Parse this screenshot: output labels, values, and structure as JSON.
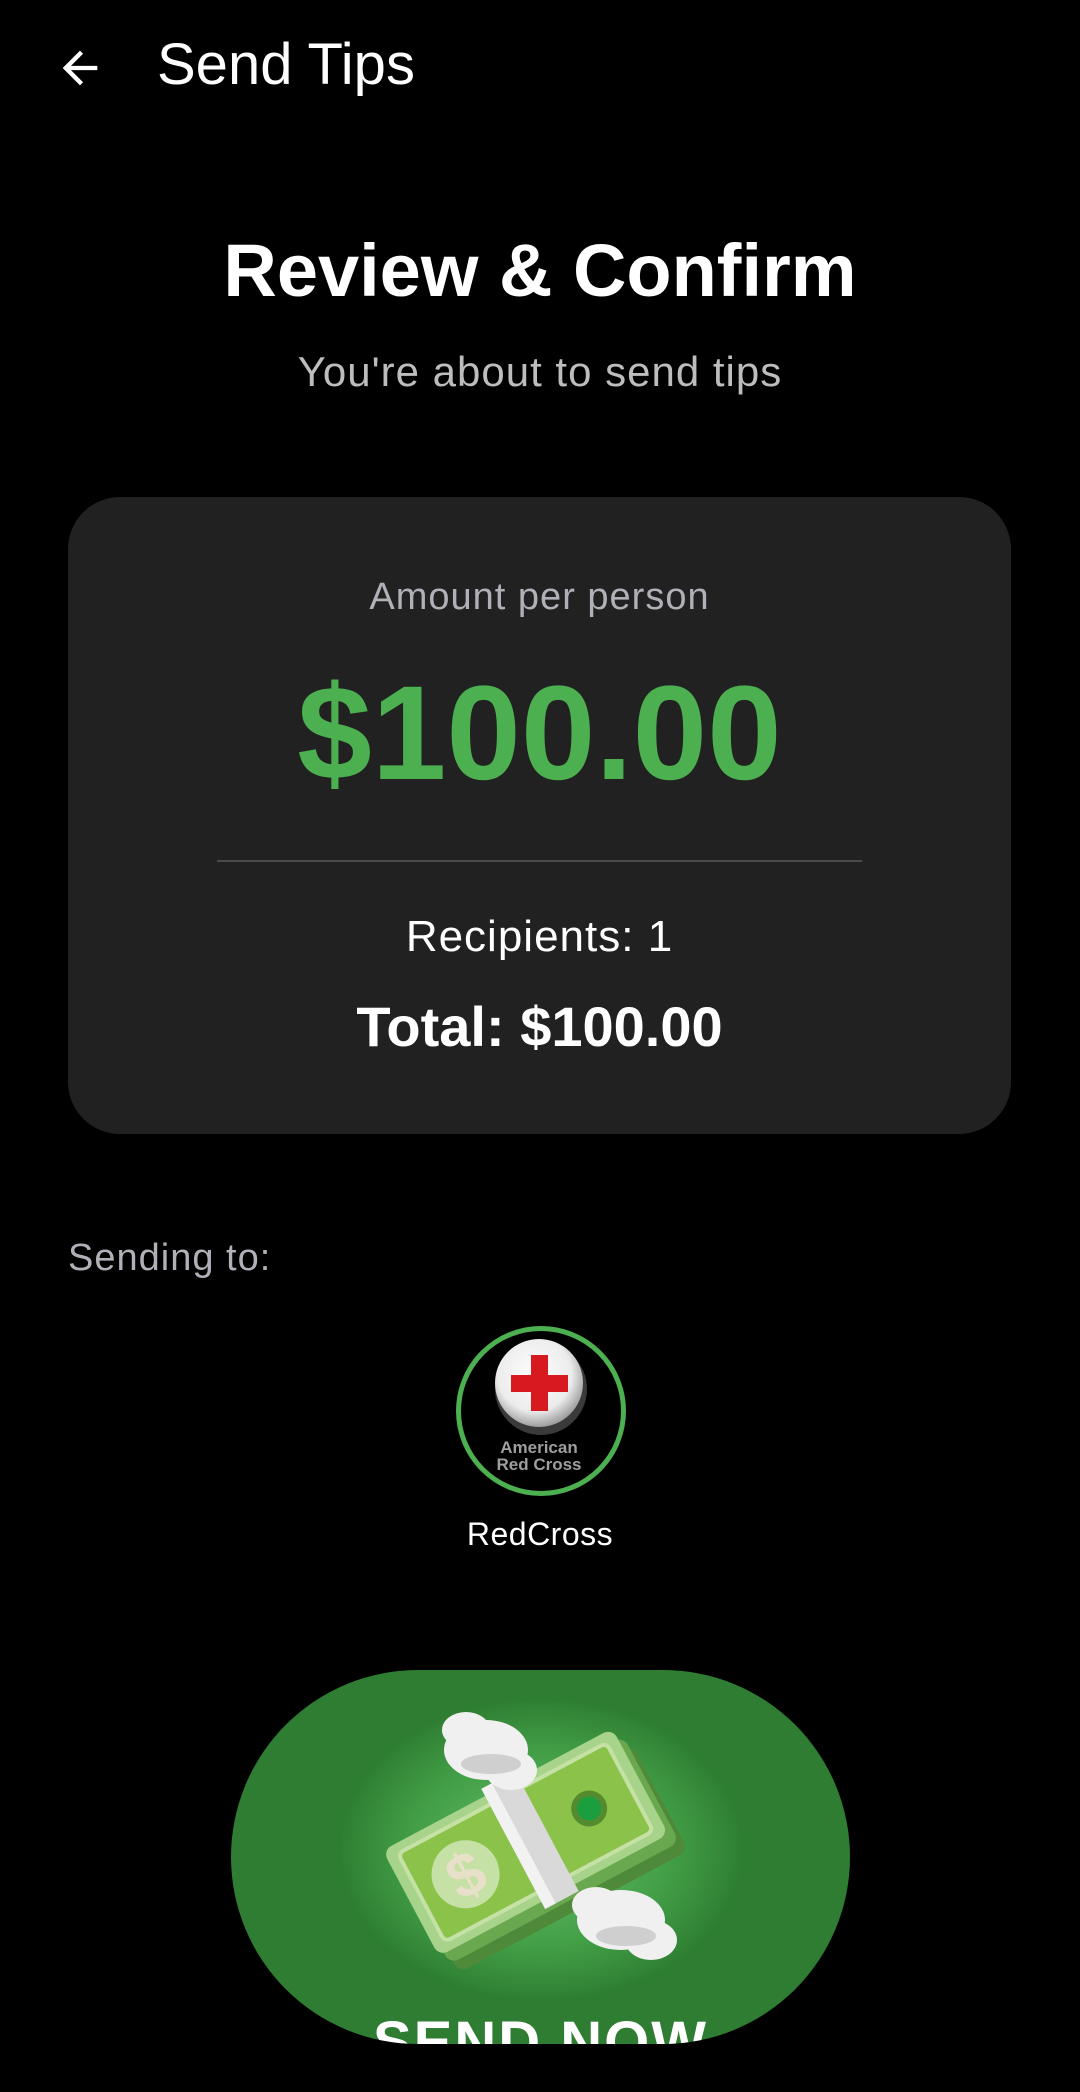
{
  "app_bar": {
    "title": "Send Tips",
    "back_icon": "arrow-left-icon"
  },
  "header": {
    "title": "Review & Confirm",
    "subtitle": "You're about to send tips"
  },
  "summary": {
    "amount_label": "Amount per person",
    "amount_value": "$100.00",
    "recipients_text": "Recipients: 1",
    "total_text": "Total: $100.00"
  },
  "recipients_section": {
    "label": "Sending to:",
    "recipients": [
      {
        "name": "RedCross",
        "logo_text_line1": "American",
        "logo_text_line2": "Red Cross",
        "icon": "red-cross-logo"
      }
    ]
  },
  "send_button": {
    "label": "SEND NOW",
    "icon": "money-with-wings-icon"
  },
  "colors": {
    "background": "#000000",
    "card": "#212121",
    "accent_green": "#4caf50",
    "button_green": "#2e7d32",
    "muted_text": "#b0b0b8",
    "red_cross": "#d71920"
  }
}
